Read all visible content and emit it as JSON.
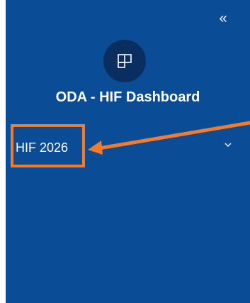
{
  "sidebar": {
    "collapse_glyph": "«",
    "collapse_icon": "double-chevron-left-icon",
    "app_icon": "layout-grid-icon",
    "app_title": "ODA - HIF Dashboard",
    "nav_items": [
      {
        "label": "HIF 2026",
        "icon": "chevron-down-icon",
        "expanded": false
      }
    ]
  },
  "colors": {
    "sidebar_background": "#0a4c96",
    "app_icon_background": "#0a2e60",
    "annotation_orange": "#f47b2a",
    "text": "#ffffff"
  }
}
